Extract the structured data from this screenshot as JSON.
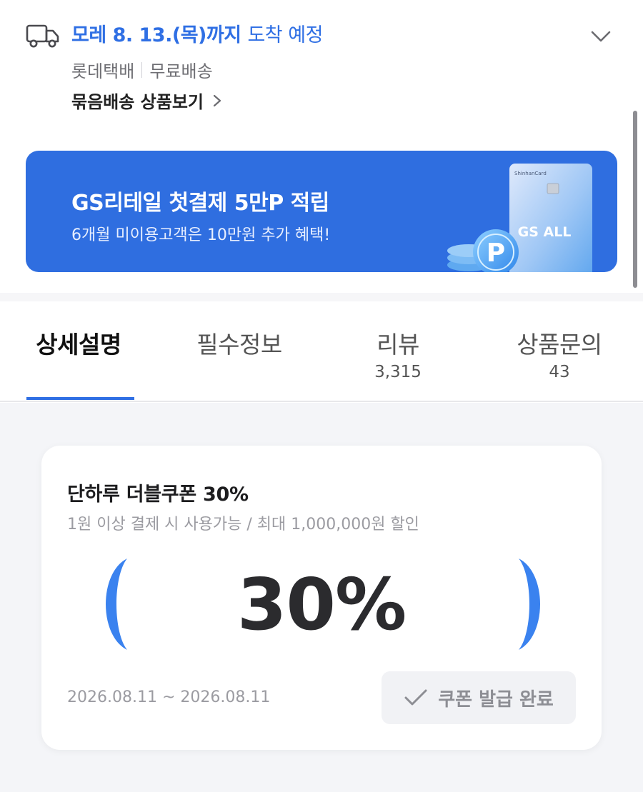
{
  "delivery": {
    "arrival_strong": "모레 8. 13.(목)까지",
    "arrival_rest": "도착 예정",
    "courier": "롯데택배",
    "shipping_fee": "무료배송",
    "bundle_link": "묶음배송 상품보기"
  },
  "banner": {
    "title": "GS리테일 첫결제 5만P 적립",
    "subtitle": "6개월 미이용고객은 10만원 추가 혜택!",
    "card_brand": "ShinhanCard",
    "card_name": "GS ALL",
    "coin_letter": "P",
    "bg_color": "#2f6ee0"
  },
  "tabs": [
    {
      "label": "상세설명",
      "count": "",
      "active": true
    },
    {
      "label": "필수정보",
      "count": "",
      "active": false
    },
    {
      "label": "리뷰",
      "count": "3,315",
      "active": false
    },
    {
      "label": "상품문의",
      "count": "43",
      "active": false
    }
  ],
  "coupon": {
    "title": "단하루 더블쿠폰 30%",
    "condition": "1원 이상 결제 시 사용가능 / 최대 1,000,000원 할인",
    "discount": "30%",
    "period": "2026.08.11 ~ 2026.08.11",
    "status_label": "쿠폰 발급 완료",
    "accent_color": "#2f6fe4"
  },
  "icons": {
    "truck": "truck-icon",
    "expand": "chevron-down-icon",
    "link": "chevron-right-icon",
    "status": "check-icon"
  }
}
